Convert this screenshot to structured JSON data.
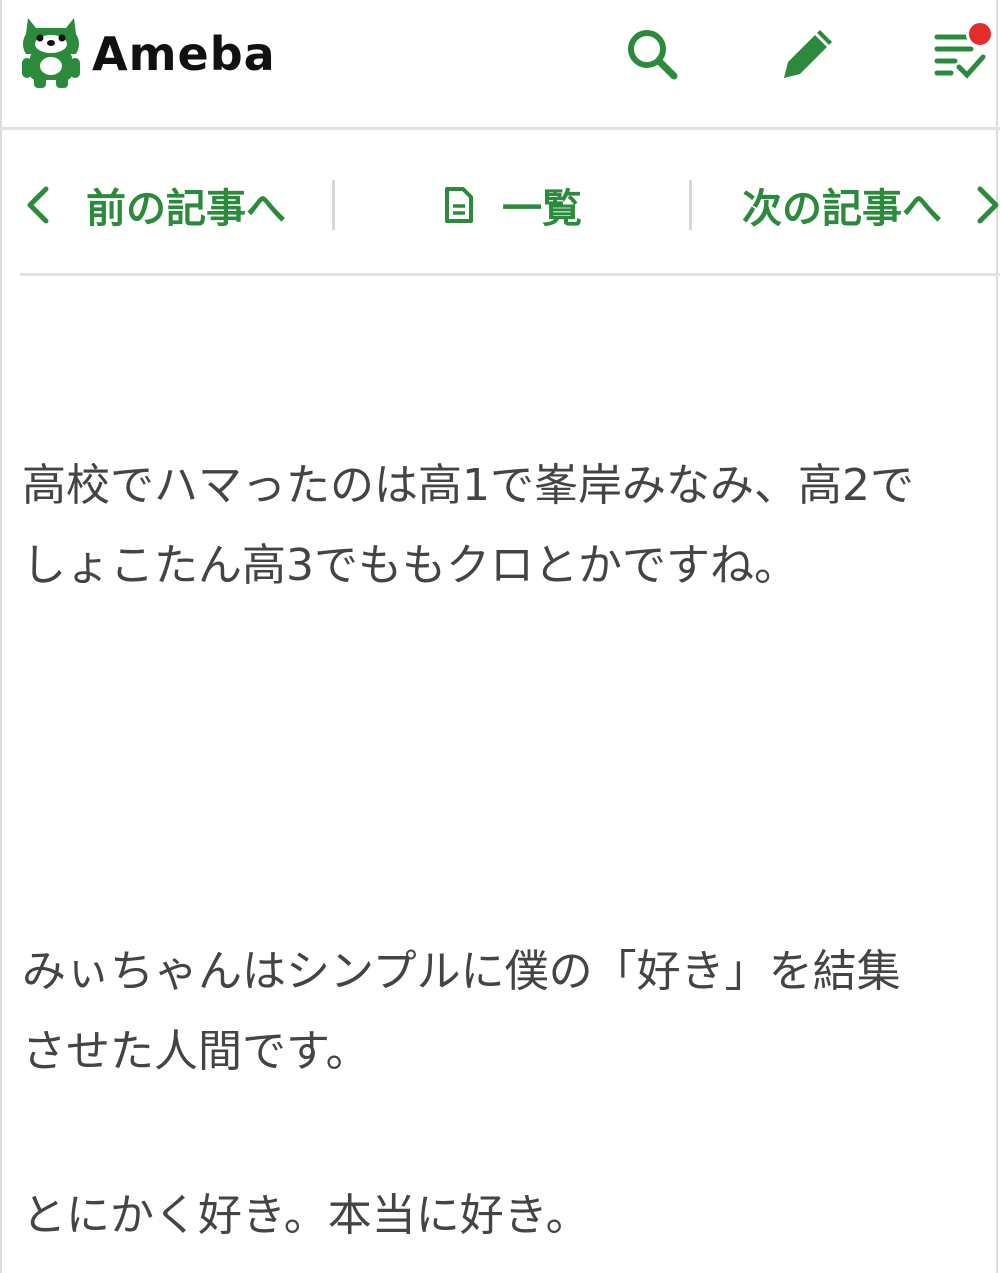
{
  "header": {
    "logo_text": "Ameba",
    "search_icon": "search-icon",
    "write_icon": "pencil-icon",
    "reader_icon": "reader-list-icon",
    "accent_color": "#2c8a3c",
    "notification_color": "#e62b2b"
  },
  "article_nav": {
    "prev_label": "前の記事へ",
    "list_label": "一覧",
    "next_label": "次の記事へ"
  },
  "content": {
    "paragraphs": [
      {
        "lines": [
          "高校でハマったのは高1で峯岸みなみ、高2で",
          "しょこたん高3でももクロとかですね。"
        ]
      },
      {
        "lines": [
          "みぃちゃんはシンプルに僕の「好き」を結集",
          "させた人間です。"
        ]
      },
      {
        "lines": [
          "とにかく好き。本当に好き。"
        ]
      }
    ]
  }
}
